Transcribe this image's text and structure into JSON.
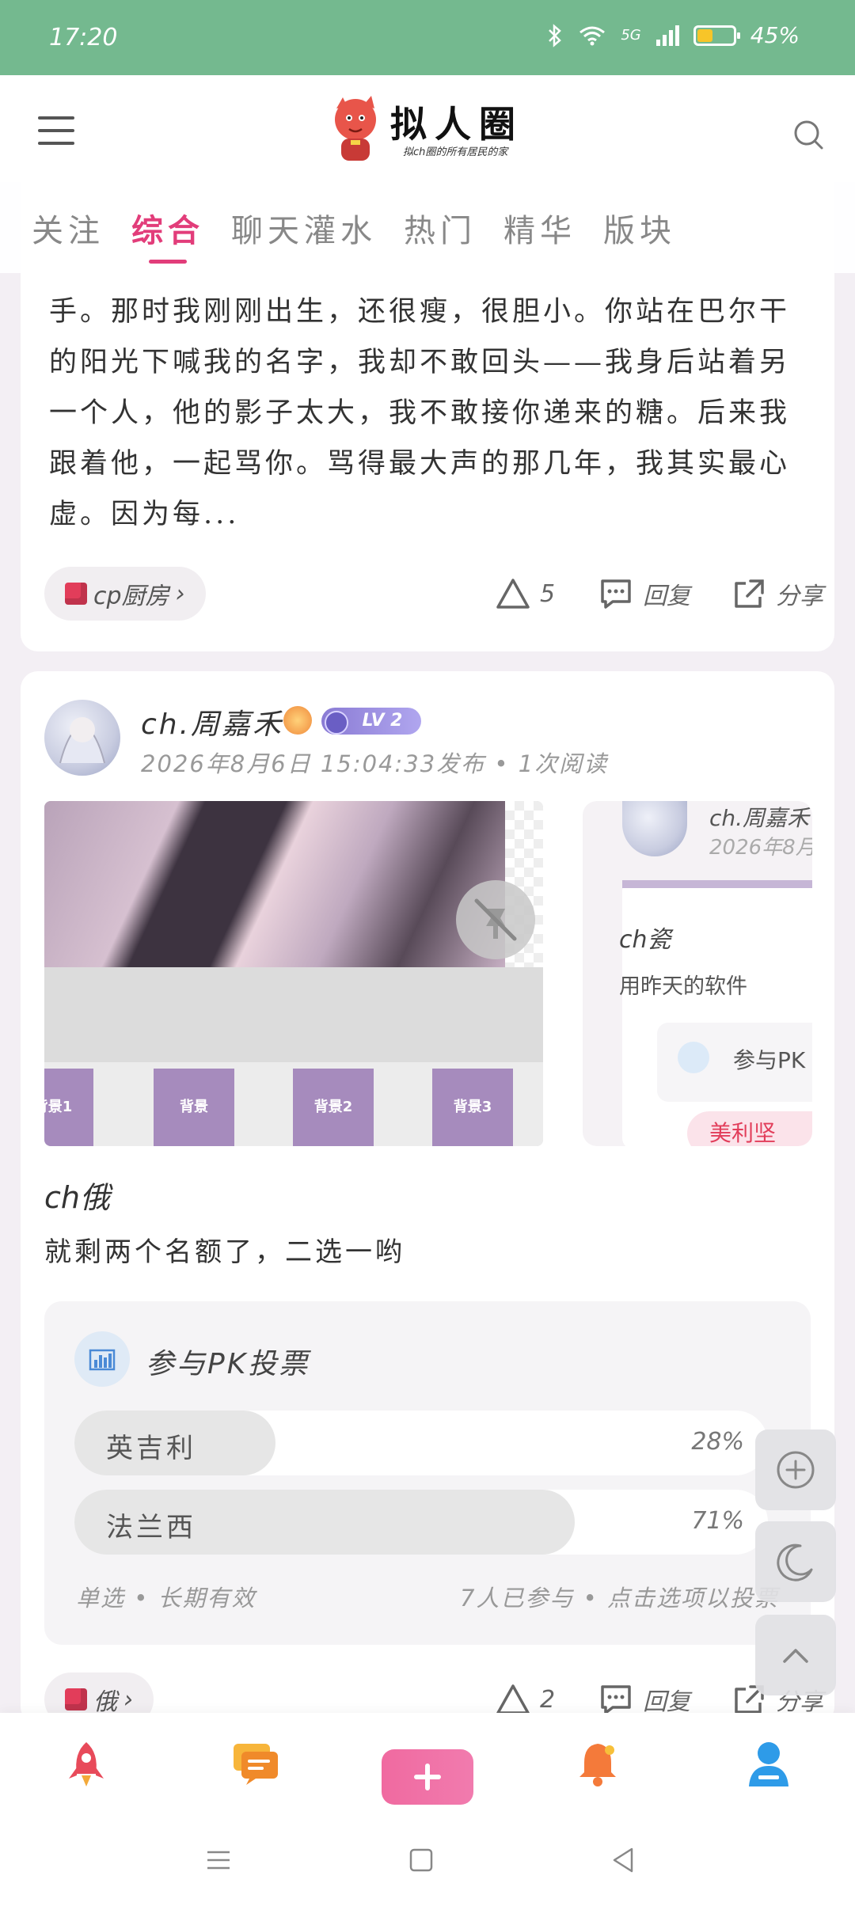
{
  "status": {
    "time": "17:20",
    "network": "5G",
    "battery": "45%"
  },
  "header": {
    "logo_title": "拟人圈",
    "logo_subtitle": "拟ch圈的所有居民的家"
  },
  "tabs": [
    "关注",
    "综合",
    "聊天灌水",
    "热门",
    "精华",
    "版块"
  ],
  "active_tab": "综合",
  "post1": {
    "body": "手。那时我刚刚出生，还很瘦，很胆小。你站在巴尔干的阳光下喊我的名字，我却不敢回头——我身后站着另一个人，他的影子太大，我不敢接你递来的糖。后来我跟着他，一起骂你。骂得最大声的那几年，我其实最心虚。因为每...",
    "tag": "cp厨房",
    "likes": "5",
    "reply_label": "回复",
    "share_label": "分享"
  },
  "post2": {
    "author": "ch.周嘉禾",
    "level": "LV 2",
    "meta": "2026年8月6日 15:04:33发布 • 1次阅读",
    "image_tiles": [
      "背景",
      "背景2",
      "背景3"
    ],
    "preview": {
      "name": "ch.周嘉禾",
      "date": "2026年8月",
      "title": "ch瓷",
      "body": "用昨天的软件",
      "vote_label": "参与PK",
      "option": "美利坚"
    },
    "title": "ch俄",
    "text": "就剩两个名额了，二选一哟",
    "vote": {
      "title": "参与PK投票",
      "options": [
        {
          "label": "英吉利",
          "percent": "28%",
          "fraction": 0.28
        },
        {
          "label": "法兰西",
          "percent": "71%",
          "fraction": 0.71
        }
      ],
      "footer_left": "单选 • 长期有效",
      "footer_right": "7人已参与 • 点击选项以投票"
    },
    "tag": "俄",
    "likes": "2",
    "reply_label": "回复",
    "share_label": "分享"
  },
  "colors": {
    "accent": "#e23d7a",
    "status_bar": "#74b98f"
  },
  "icons": {
    "fab": [
      "plus-circle-icon",
      "moon-icon",
      "chevron-up-icon"
    ],
    "bottom_nav": [
      "rocket-icon",
      "chat-icon",
      "add-icon",
      "bell-icon",
      "user-icon"
    ]
  }
}
